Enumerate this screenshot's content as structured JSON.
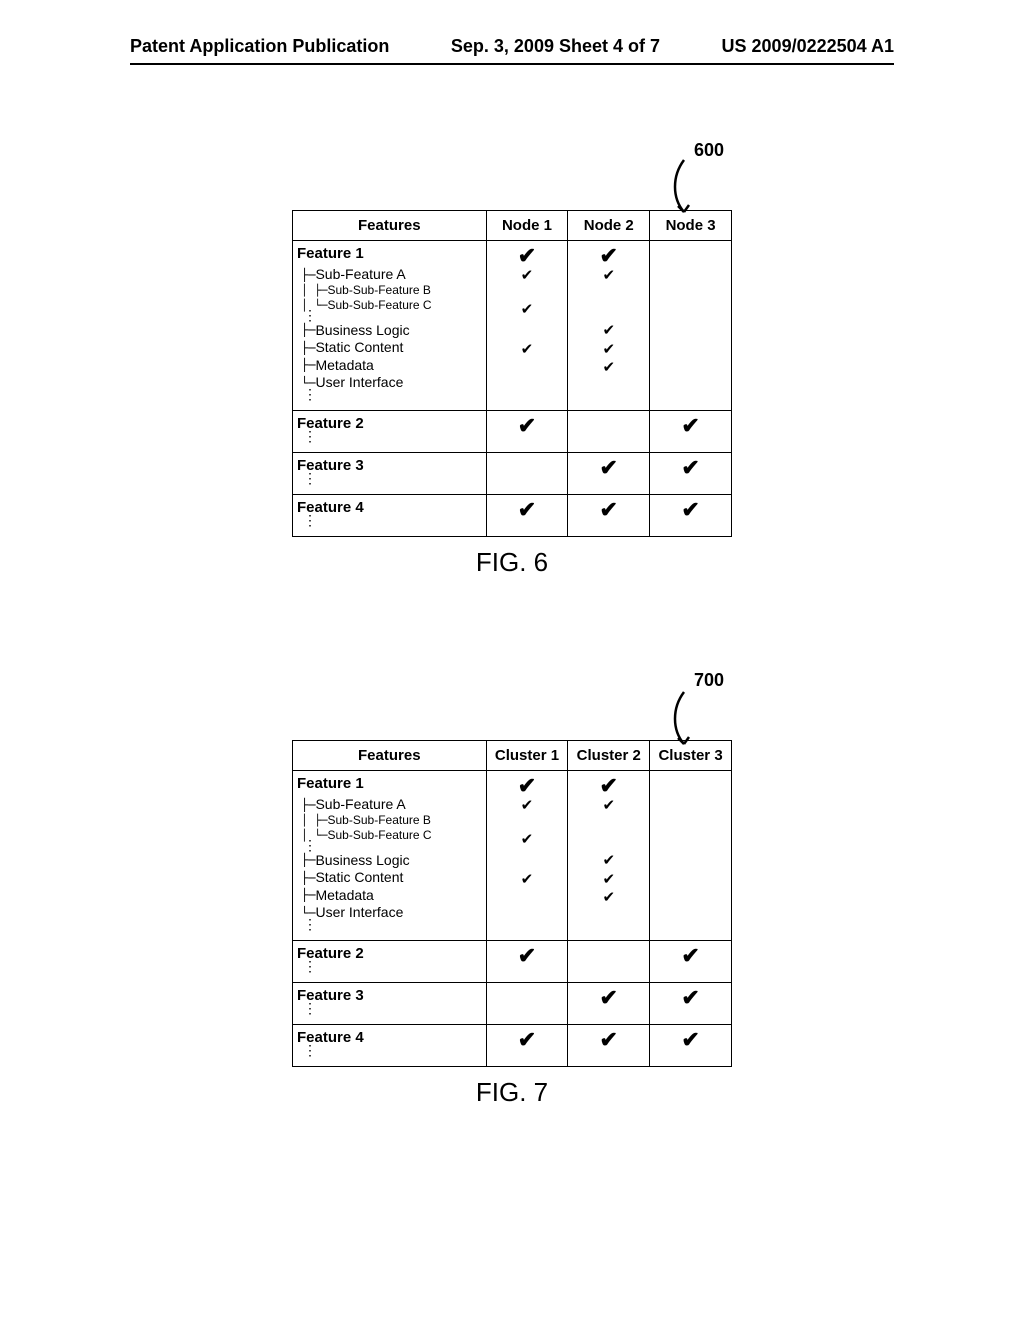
{
  "header": {
    "left": "Patent Application Publication",
    "center": "Sep. 3, 2009  Sheet 4 of 7",
    "right": "US 2009/0222504 A1"
  },
  "fig6": {
    "ref": "600",
    "caption": "FIG. 6",
    "headers": {
      "features": "Features",
      "c1": "Node 1",
      "c2": "Node 2",
      "c3": "Node 3"
    },
    "rows": {
      "f1": {
        "title": "Feature 1",
        "sub_a": "Sub-Feature A",
        "sub_b": "Sub-Sub-Feature B",
        "sub_c": "Sub-Sub-Feature C",
        "bl": "Business Logic",
        "sc": "Static Content",
        "md": "Metadata",
        "ui": "User Interface"
      },
      "f2": {
        "title": "Feature 2"
      },
      "f3": {
        "title": "Feature 3"
      },
      "f4": {
        "title": "Feature 4"
      }
    }
  },
  "fig7": {
    "ref": "700",
    "caption": "FIG. 7",
    "headers": {
      "features": "Features",
      "c1": "Cluster 1",
      "c2": "Cluster 2",
      "c3": "Cluster 3"
    },
    "rows": {
      "f1": {
        "title": "Feature 1",
        "sub_a": "Sub-Feature A",
        "sub_b": "Sub-Sub-Feature B",
        "sub_c": "Sub-Sub-Feature C",
        "bl": "Business Logic",
        "sc": "Static Content",
        "md": "Metadata",
        "ui": "User Interface"
      },
      "f2": {
        "title": "Feature 2"
      },
      "f3": {
        "title": "Feature 3"
      },
      "f4": {
        "title": "Feature 4"
      }
    }
  },
  "glyph": {
    "check": "✔",
    "vdots": "⋮"
  },
  "chart_data": [
    {
      "type": "table",
      "title": "FIG. 6 — Feature allocation across Nodes (reference 600)",
      "columns": [
        "Feature",
        "Node 1",
        "Node 2",
        "Node 3"
      ],
      "rows": [
        [
          "Feature 1",
          true,
          true,
          false
        ],
        [
          "Feature 1 / Sub-Feature A",
          true,
          true,
          false
        ],
        [
          "Feature 1 / Sub-Feature A / Sub-Sub-Feature B",
          false,
          false,
          false
        ],
        [
          "Feature 1 / Sub-Feature A / Sub-Sub-Feature C",
          true,
          false,
          false
        ],
        [
          "Feature 1 / Business Logic",
          false,
          true,
          false
        ],
        [
          "Feature 1 / Static Content",
          true,
          true,
          false
        ],
        [
          "Feature 1 / Metadata",
          false,
          true,
          false
        ],
        [
          "Feature 1 / User Interface",
          false,
          false,
          false
        ],
        [
          "Feature 2",
          true,
          false,
          true
        ],
        [
          "Feature 3",
          false,
          true,
          true
        ],
        [
          "Feature 4",
          true,
          true,
          true
        ]
      ]
    },
    {
      "type": "table",
      "title": "FIG. 7 — Feature allocation across Clusters (reference 700)",
      "columns": [
        "Feature",
        "Cluster 1",
        "Cluster 2",
        "Cluster 3"
      ],
      "rows": [
        [
          "Feature 1",
          true,
          true,
          false
        ],
        [
          "Feature 1 / Sub-Feature A",
          true,
          true,
          false
        ],
        [
          "Feature 1 / Sub-Feature A / Sub-Sub-Feature B",
          false,
          false,
          false
        ],
        [
          "Feature 1 / Sub-Feature A / Sub-Sub-Feature C",
          true,
          false,
          false
        ],
        [
          "Feature 1 / Business Logic",
          false,
          true,
          false
        ],
        [
          "Feature 1 / Static Content",
          true,
          true,
          false
        ],
        [
          "Feature 1 / Metadata",
          false,
          true,
          false
        ],
        [
          "Feature 1 / User Interface",
          false,
          false,
          false
        ],
        [
          "Feature 2",
          true,
          false,
          true
        ],
        [
          "Feature 3",
          false,
          true,
          true
        ],
        [
          "Feature 4",
          true,
          true,
          true
        ]
      ]
    }
  ]
}
